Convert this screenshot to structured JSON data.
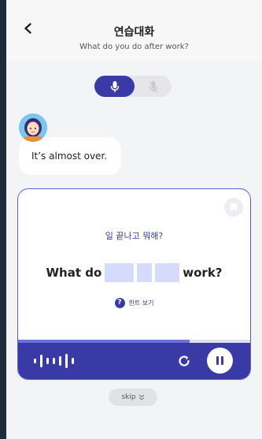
{
  "header": {
    "title": "연습대화",
    "subtitle": "What do you do after work?"
  },
  "icons": {
    "back": "chevron-left-icon",
    "mic_on": "microphone-icon",
    "mic_off": "microphone-off-icon",
    "bookmark": "bookmark-icon",
    "hint": "question-icon",
    "waveform": "waveform-icon",
    "retry": "retry-icon",
    "pause": "pause-icon",
    "skip": "chevron-double-down-icon"
  },
  "colors": {
    "accent": "#3a3aa6",
    "accent_light": "#d7dbfb",
    "progress": "#6a70e0",
    "background": "#f3f4f6"
  },
  "chat": {
    "message": "It’s almost over."
  },
  "quiz": {
    "prompt_ko": "일 끝나고 뭐해?",
    "sentence_start": "What do",
    "blank_count": 3,
    "sentence_end": "work?",
    "hint_label": "힌트 보기",
    "progress_fraction": 0.74
  },
  "skip_label": "skip"
}
